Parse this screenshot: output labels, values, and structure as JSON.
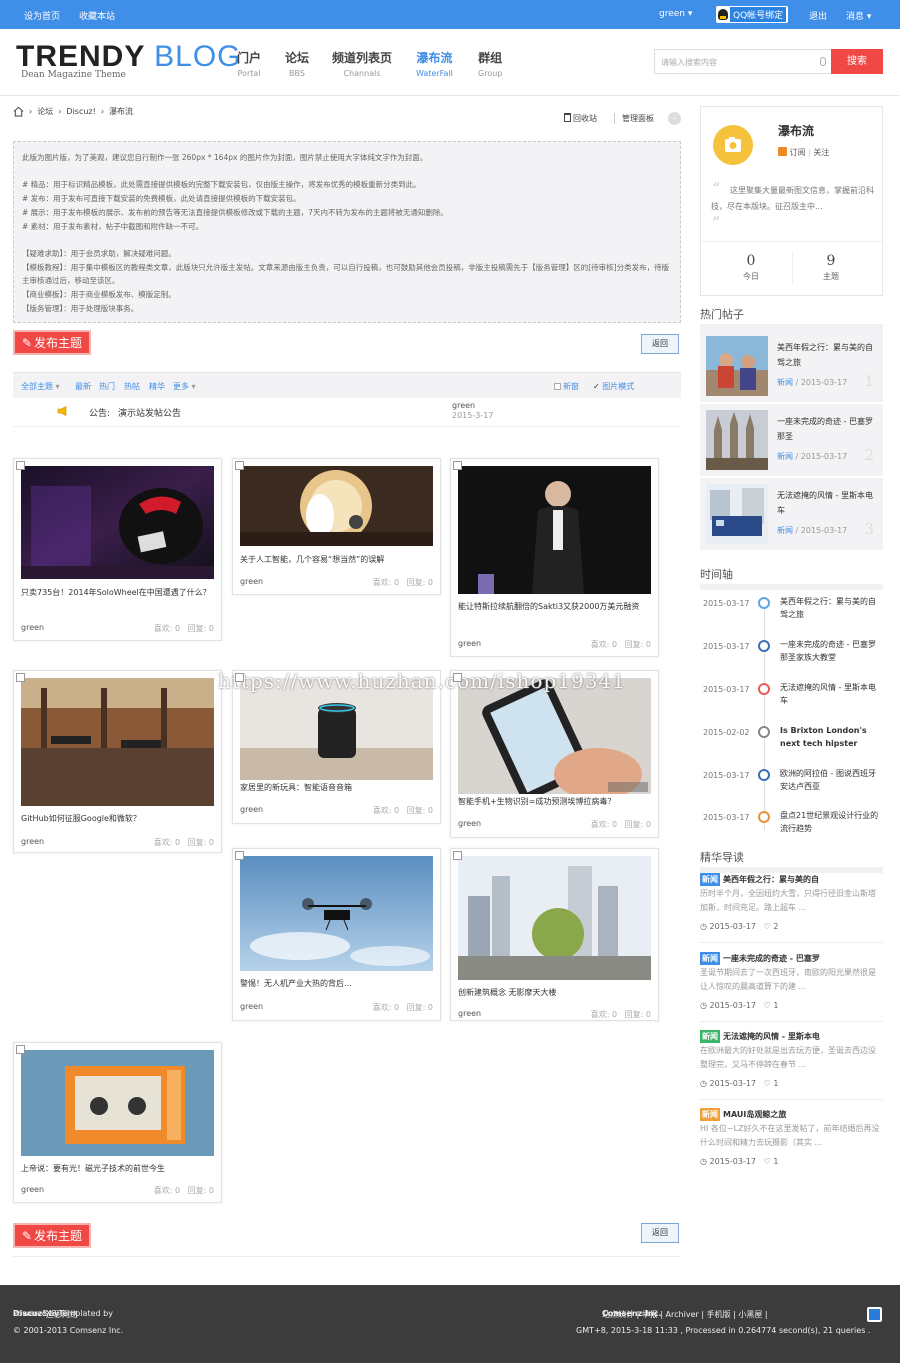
{
  "topbar": {
    "set_home": "设为首页",
    "bookmark": "收藏本站",
    "user": "green",
    "qq_label": "QQ帐号绑定",
    "logout": "退出",
    "messages": "消息"
  },
  "brand": {
    "logo_main": "TRENDY",
    "logo_accent": "BLOG",
    "subtitle": "Dean Magazine Theme"
  },
  "nav": [
    {
      "zh": "门户",
      "en": "Portal"
    },
    {
      "zh": "论坛",
      "en": "BBS"
    },
    {
      "zh": "频道列表页",
      "en": "Channals"
    },
    {
      "zh": "瀑布流",
      "en": "WaterFall"
    },
    {
      "zh": "群组",
      "en": "Group"
    }
  ],
  "search": {
    "placeholder": "请输入搜索内容",
    "button": "搜索"
  },
  "breadcrumb": {
    "forum": "论坛",
    "discuz": "Discuz!",
    "current": "瀑布流"
  },
  "toolbar": {
    "recycle": "回收站",
    "manage": "管理面板"
  },
  "notice": {
    "intro": "此版为图片版，为了美观，建议您自行制作一张 260px * 164px 的图片作为封面，图片禁止使用大字体纯文字作为封面。",
    "lines": [
      "# 精品：用于标识精品模板，此处需直接提供模板的完整下载安装包，仅由版主操作，将发布优秀的模板重新分类到此。",
      "# 发布：用于发布可直接下载安装的免费模板，此处请直接提供模板的下载安装包。",
      "# 展示：用于发布模板的展示、发布前的预告等无法直接提供模板修改或下载的主题，7天内不转为发布的主题将被无通知删除。",
      "# 素材：用于发布素材，帖子中截图和附件缺一不可。"
    ],
    "rules": [
      "【疑难求助】：用于会员求助，解决疑难问题。",
      "【模板教程】：用于集中模板区的教程类文章，此版块只允许版主发帖。文章来源由版主负责，可以自行投稿，也可鼓励其他会员投稿，非版主投稿需先于【版务管理】区的[待审核]分类发布，待版主审核通过后，移动至该区。",
      "【商业模板】：用于商业模板发布、模版定制。",
      "【版务管理】：用于处理版块事务。"
    ]
  },
  "actions": {
    "post": "发布主题",
    "back": "返回"
  },
  "filters": {
    "all": "全部主题",
    "latest": "最新",
    "hot": "热门",
    "trending": "热帖",
    "digest": "精华",
    "more": "更多",
    "new_window": "新窗",
    "image_mode": "图片模式"
  },
  "announcement": {
    "label": "公告:",
    "title": "演示站发帖公告",
    "author": "green",
    "date": "2015-3-17"
  },
  "cards": [
    {
      "title": "只卖735台！2014年SoloWheel在中国遭遇了什么？",
      "author": "green",
      "likes": "喜欢: 0",
      "replies": "回复: 0"
    },
    {
      "title": "关于人工智能，几个容易“想当然”的误解",
      "author": "green",
      "likes": "喜欢: 0",
      "replies": "回复: 0"
    },
    {
      "title": "能让特斯拉续航翻倍的Sakti3又获2000万美元融资",
      "author": "green",
      "likes": "喜欢: 0",
      "replies": "回复: 0"
    },
    {
      "title": "GitHub如何征服Google和微软？",
      "author": "green",
      "likes": "喜欢: 0",
      "replies": "回复: 0"
    },
    {
      "title": "家居里的新玩具：智能语音音箱",
      "author": "green",
      "likes": "喜欢: 0",
      "replies": "回复: 0"
    },
    {
      "title": "智能手机+生物识别=成功预测埃博拉病毒？",
      "author": "green",
      "likes": "喜欢: 0",
      "replies": "回复: 0"
    },
    {
      "title": "警惕！无人机产业大热的背后...",
      "author": "green",
      "likes": "喜欢: 0",
      "replies": "回复: 0"
    },
    {
      "title": "创新建筑概念 无影摩天大楼",
      "author": "green",
      "likes": "喜欢: 0",
      "replies": "回复: 0"
    },
    {
      "title": "上帝说：要有光！磁光子技术的前世今生",
      "author": "green",
      "likes": "喜欢: 0",
      "replies": "回复: 0"
    }
  ],
  "watermark": "https://www.huzhan.com/ishop19341",
  "forum_card": {
    "name": "瀑布流",
    "subscribe": "订阅",
    "follow": "关注",
    "quote": "这里聚集大量最新图文信息，掌握前沿科技，尽在本版块。征召版主中...",
    "today_value": "0",
    "today_label": "今日",
    "topics_value": "9",
    "topics_label": "主题"
  },
  "hot_posts": {
    "title": "热门帖子",
    "items": [
      {
        "title": "美西年假之行：累与美的自驾之旅",
        "tag": "新闻",
        "date": "2015-03-17",
        "rank": "1"
      },
      {
        "title": "一座未完成的奇迹 - 巴塞罗那圣",
        "tag": "新闻",
        "date": "2015-03-17",
        "rank": "2"
      },
      {
        "title": "无法遮掩的风情 - 里斯本电车",
        "tag": "新闻",
        "date": "2015-03-17",
        "rank": "3"
      }
    ]
  },
  "timeline": {
    "title": "时间轴",
    "items": [
      {
        "date": "2015-03-17",
        "title": "美西年假之行：累与美的自驾之旅",
        "color": "#5aa7e6"
      },
      {
        "date": "2015-03-17",
        "title": "一座未完成的奇迹 - 巴塞罗那圣家族大教堂",
        "color": "#3a6fb5"
      },
      {
        "date": "2015-03-17",
        "title": "无法遮掩的风情 - 里斯本电车",
        "color": "#e85a57"
      },
      {
        "date": "2015-02-02",
        "title": "Is Brixton London's next tech hipster",
        "color": "#888888"
      },
      {
        "date": "2015-03-17",
        "title": "欧洲的阿拉伯 - 图说西班牙安达卢西亚",
        "color": "#3a6fb5"
      },
      {
        "date": "2015-03-17",
        "title": "盘点21世纪景观设计行业的流行趋势",
        "color": "#e8923a"
      }
    ]
  },
  "digest": {
    "title": "精华导读",
    "items": [
      {
        "tag": "新闻",
        "tag_color": "#3f8ee8",
        "title": "美西年假之行：累与美的自",
        "excerpt": "历时半个月，全因纽约大雪，只得行径旧金山斯塔加斯，时间充足。路上超车 ...",
        "date": "2015-03-17",
        "likes": "2"
      },
      {
        "tag": "新闻",
        "tag_color": "#3f8ee8",
        "title": "一座未完成的奇迹 - 巴塞罗",
        "excerpt": "圣诞节期间去了一次西班牙，南欧的阳光果然很是让人惊叹的晨高道算下的建 ...",
        "date": "2015-03-17",
        "likes": "1"
      },
      {
        "tag": "新闻",
        "tag_color": "#3cb46a",
        "title": "无法遮掩的风情 - 里斯本电",
        "excerpt": "在欧洲最大的好处就是出去玩方便，圣诞去西边没整理完，又马不停蹄在春节 ...",
        "date": "2015-03-17",
        "likes": "1"
      },
      {
        "tag": "新闻",
        "tag_color": "#f0a03a",
        "title": "MAUI岛观鲸之旅",
        "excerpt": "HI 各位~LZ好久不在这里发帖了，前年结婚后再没什么时间和精力去玩摄影（其实 ...",
        "date": "2015-03-17",
        "likes": "1"
      }
    ]
  },
  "footer": {
    "powered": "Powered by",
    "discuz": "Discuz!",
    "version": "X3 Templated by",
    "templater": "迪恩网络",
    "copyright": "© 2001-2013 Comsenz Inc.",
    "links": "站点统计 | 举报 | Archiver | 手机版 | 小黑屋 |",
    "company": "Comsenz Inc.",
    "stats": "GMT+8, 2015-3-18 11:33 , Processed in 0.264774 second(s), 21 queries ."
  }
}
